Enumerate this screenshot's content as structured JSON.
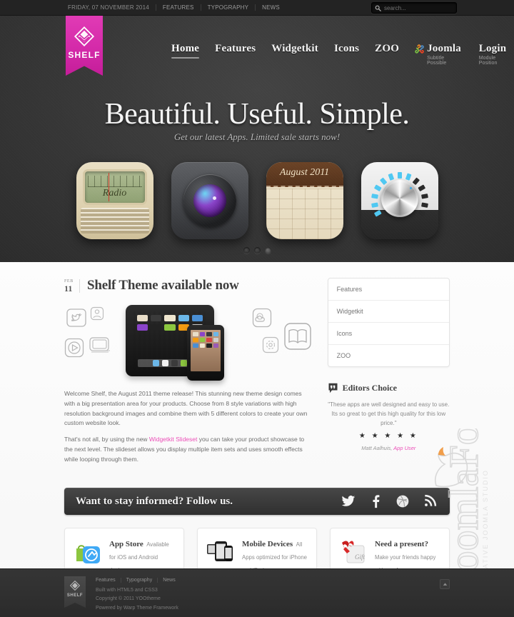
{
  "topbar": {
    "date": "FRIDAY, 07 NOVEMBER 2014",
    "links": [
      "FEATURES",
      "TYPOGRAPHY",
      "NEWS"
    ],
    "search": {
      "placeholder": "search...",
      "value": "",
      "icon": "search-icon"
    }
  },
  "logo": {
    "text": "SHELF",
    "icon": "stacked-diamond-icon",
    "color": "#d42aa9"
  },
  "nav": [
    {
      "label": "Home",
      "sub": "",
      "active": true,
      "icon": ""
    },
    {
      "label": "Features",
      "sub": "",
      "active": false,
      "icon": ""
    },
    {
      "label": "Widgetkit",
      "sub": "",
      "active": false,
      "icon": ""
    },
    {
      "label": "Icons",
      "sub": "",
      "active": false,
      "icon": ""
    },
    {
      "label": "ZOO",
      "sub": "",
      "active": false,
      "icon": ""
    },
    {
      "label": "Joomla",
      "sub": "Subtitle Possible",
      "active": false,
      "icon": "joomla-icon"
    },
    {
      "label": "Login",
      "sub": "Module Position",
      "active": false,
      "icon": ""
    }
  ],
  "hero": {
    "title": "Beautiful. Useful. Simple.",
    "subtitle": "Get our latest Apps. Limited sale starts now!",
    "apps": [
      {
        "name": "radio-app-icon",
        "label": "Radio"
      },
      {
        "name": "camera-app-icon",
        "label": ""
      },
      {
        "name": "calendar-app-icon",
        "label": "August 2011"
      },
      {
        "name": "volume-knob-app-icon",
        "label": ""
      }
    ],
    "slider_dots": 3,
    "active_dot": 3
  },
  "post": {
    "date_month": "FEB",
    "date_day": "11",
    "title": "Shelf Theme available now",
    "image_name": "tablet-and-phone-illustration",
    "paragraphs": [
      "Welcome Shelf, the August 2011 theme release! This stunning new theme design comes with a big presentation area for your products. Choose from 8 style variations with high resolution background images and combine them with 5 different colors to create your own custom website look.",
      "That's not all, by using the new Widgetkit Slideset you can take your product showcase to the next level. The slideset allows you display multiple item sets and uses smooth effects while looping through them."
    ],
    "link_text": "Widgetkit Slideset",
    "para2_before": "That's not all, by using the new ",
    "para2_after": " you can take your product showcase to the next level. The slideset allows you display multiple item sets and uses smooth effects while looping through them."
  },
  "aside": {
    "menu": [
      "Features",
      "Widgetkit",
      "Icons",
      "ZOO"
    ],
    "editors": {
      "title": "Editors Choice",
      "icon": "quote-icon",
      "quote": "\"These apps are well designed and easy to use. Its so great to get this high quality for this low price.\"",
      "stars": "★ ★ ★ ★ ★",
      "rating": 5,
      "author_name": "Matt Aalhuis, ",
      "author_role": "App User"
    }
  },
  "follow": {
    "text": "Want to stay informed? Follow us.",
    "socials": [
      "twitter-icon",
      "facebook-icon",
      "dribbble-icon",
      "rss-icon"
    ]
  },
  "boxes": [
    {
      "icon": "app-store-icon",
      "title": "App Store",
      "desc": "Available for iOS and Android devices."
    },
    {
      "icon": "mobile-devices-icon",
      "title": "Mobile Devices",
      "desc": "All Apps optimized for iPhone and iPad."
    },
    {
      "icon": "gift-present-icon",
      "title": "Need a present?",
      "desc": "Make your friends happy with our Apps."
    }
  ],
  "footer": {
    "logo_text": "SHELF",
    "links": [
      "Features",
      "Typography",
      "News"
    ],
    "line1": "Built with HTML5 and CSS3",
    "line2": "Copyright © 2011 YOOtheme",
    "line3": "Powered by Warp Theme Framework",
    "totop": "to-top-icon"
  },
  "watermark": {
    "text": "JoomlaFox",
    "subtext": "CREATIVE JOOMLA STUDIO"
  }
}
